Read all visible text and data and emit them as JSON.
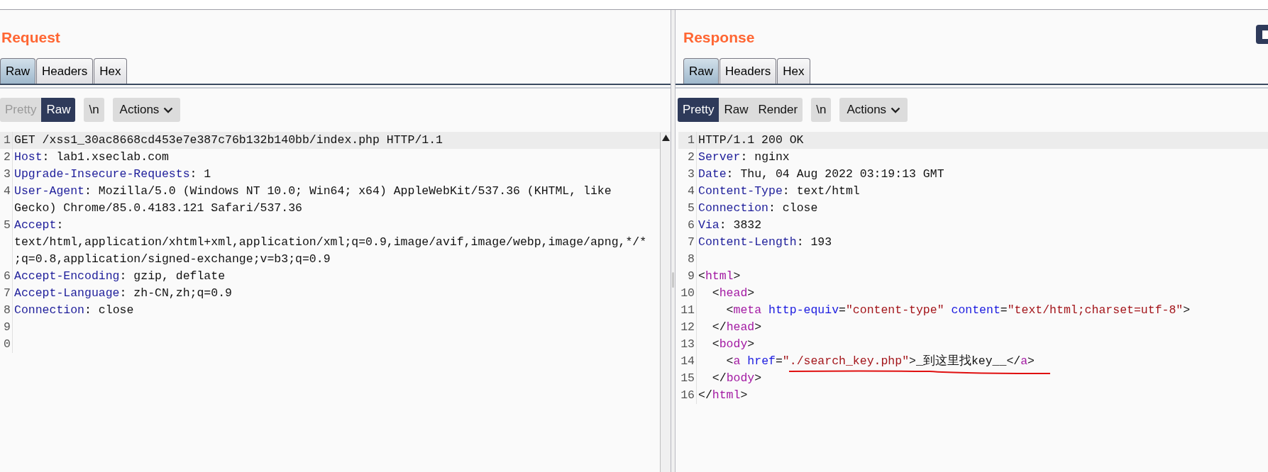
{
  "request": {
    "title": "Request",
    "tabs": [
      {
        "label": "Raw",
        "selected": true
      },
      {
        "label": "Headers",
        "selected": false
      },
      {
        "label": "Hex",
        "selected": false
      }
    ],
    "view_modes": [
      {
        "label": "Pretty",
        "selected": false,
        "disabled": true
      },
      {
        "label": "Raw",
        "selected": true,
        "disabled": false
      }
    ],
    "newline_button": "\\n",
    "actions_button": "Actions",
    "lines": [
      {
        "number": "1",
        "highlighted": true,
        "segments": [
          {
            "kind": "plain",
            "text": "GET /xss1_30ac8668cd453e7e387c76b132b140bb/index.php HTTP/1.1"
          }
        ]
      },
      {
        "number": "2",
        "highlighted": false,
        "segments": [
          {
            "kind": "header_name",
            "text": "Host"
          },
          {
            "kind": "plain",
            "text": ": lab1.xseclab.com"
          }
        ]
      },
      {
        "number": "3",
        "highlighted": false,
        "segments": [
          {
            "kind": "header_name",
            "text": "Upgrade-Insecure-Requests"
          },
          {
            "kind": "plain",
            "text": ": 1"
          }
        ]
      },
      {
        "number": "4",
        "highlighted": false,
        "segments": [
          {
            "kind": "header_name",
            "text": "User-Agent"
          },
          {
            "kind": "plain",
            "text": ": Mozilla/5.0 (Windows NT 10.0; Win64; x64) AppleWebKit/537.36 (KHTML, like Gecko) Chrome/85.0.4183.121 Safari/537.36"
          }
        ]
      },
      {
        "number": "5",
        "highlighted": false,
        "segments": [
          {
            "kind": "header_name",
            "text": "Accept"
          },
          {
            "kind": "plain",
            "text": ": text/html,application/xhtml+xml,application/xml;q=0.9,image/avif,image/webp,image/apng,*/*;q=0.8,application/signed-exchange;v=b3;q=0.9"
          }
        ]
      },
      {
        "number": "6",
        "highlighted": false,
        "segments": [
          {
            "kind": "header_name",
            "text": "Accept-Encoding"
          },
          {
            "kind": "plain",
            "text": ": gzip, deflate"
          }
        ]
      },
      {
        "number": "7",
        "highlighted": false,
        "segments": [
          {
            "kind": "header_name",
            "text": "Accept-Language"
          },
          {
            "kind": "plain",
            "text": ": zh-CN,zh;q=0.9"
          }
        ]
      },
      {
        "number": "8",
        "highlighted": false,
        "segments": [
          {
            "kind": "header_name",
            "text": "Connection"
          },
          {
            "kind": "plain",
            "text": ": close"
          }
        ]
      },
      {
        "number": "9",
        "highlighted": false
      },
      {
        "number": "0",
        "highlighted": false
      }
    ]
  },
  "response": {
    "title": "Response",
    "tabs": [
      {
        "label": "Raw",
        "selected": true
      },
      {
        "label": "Headers",
        "selected": false
      },
      {
        "label": "Hex",
        "selected": false
      }
    ],
    "view_modes": [
      {
        "label": "Pretty",
        "selected": true,
        "disabled": false
      },
      {
        "label": "Raw",
        "selected": false,
        "disabled": false
      },
      {
        "label": "Render",
        "selected": false,
        "disabled": false
      }
    ],
    "newline_button": "\\n",
    "actions_button": "Actions",
    "lines": [
      {
        "number": "1",
        "highlighted": true,
        "underlined": false,
        "segments": [
          {
            "kind": "plain",
            "text": "HTTP/1.1 200 OK"
          }
        ]
      },
      {
        "number": "2",
        "highlighted": false,
        "underlined": false,
        "segments": [
          {
            "kind": "header_name",
            "text": "Server"
          },
          {
            "kind": "plain",
            "text": ": nginx"
          }
        ]
      },
      {
        "number": "3",
        "highlighted": false,
        "underlined": false,
        "segments": [
          {
            "kind": "header_name",
            "text": "Date"
          },
          {
            "kind": "plain",
            "text": ": Thu, 04 Aug 2022 03:19:13 GMT"
          }
        ]
      },
      {
        "number": "4",
        "highlighted": false,
        "underlined": false,
        "segments": [
          {
            "kind": "header_name",
            "text": "Content-Type"
          },
          {
            "kind": "plain",
            "text": ": text/html"
          }
        ]
      },
      {
        "number": "5",
        "highlighted": false,
        "underlined": false,
        "segments": [
          {
            "kind": "header_name",
            "text": "Connection"
          },
          {
            "kind": "plain",
            "text": ": close"
          }
        ]
      },
      {
        "number": "6",
        "highlighted": false,
        "underlined": false,
        "segments": [
          {
            "kind": "header_name",
            "text": "Via"
          },
          {
            "kind": "plain",
            "text": ": 3832"
          }
        ]
      },
      {
        "number": "7",
        "highlighted": false,
        "underlined": false,
        "segments": [
          {
            "kind": "header_name",
            "text": "Content-Length"
          },
          {
            "kind": "plain",
            "text": ": 193"
          }
        ]
      },
      {
        "number": "8",
        "highlighted": false,
        "underlined": false
      },
      {
        "number": "9",
        "highlighted": false,
        "underlined": false,
        "segments": [
          {
            "kind": "plain",
            "text": "<"
          },
          {
            "kind": "tag",
            "text": "html"
          },
          {
            "kind": "plain",
            "text": ">"
          }
        ]
      },
      {
        "number": "10",
        "highlighted": false,
        "underlined": false,
        "segments": [
          {
            "kind": "plain",
            "text": "  <"
          },
          {
            "kind": "tag",
            "text": "head"
          },
          {
            "kind": "plain",
            "text": ">"
          }
        ]
      },
      {
        "number": "11",
        "highlighted": false,
        "underlined": false,
        "segments": [
          {
            "kind": "plain",
            "text": "    <"
          },
          {
            "kind": "tag",
            "text": "meta"
          },
          {
            "kind": "attr",
            "text": " http-equiv"
          },
          {
            "kind": "plain",
            "text": "="
          },
          {
            "kind": "attr_value",
            "text": "\"content-type\""
          },
          {
            "kind": "attr",
            "text": " content"
          },
          {
            "kind": "plain",
            "text": "="
          },
          {
            "kind": "attr_value",
            "text": "\"text/html;charset=utf-8\""
          },
          {
            "kind": "plain",
            "text": ">"
          }
        ]
      },
      {
        "number": "12",
        "highlighted": false,
        "underlined": false,
        "segments": [
          {
            "kind": "plain",
            "text": "  </"
          },
          {
            "kind": "tag",
            "text": "head"
          },
          {
            "kind": "plain",
            "text": ">"
          }
        ]
      },
      {
        "number": "13",
        "highlighted": false,
        "underlined": false,
        "segments": [
          {
            "kind": "plain",
            "text": "  <"
          },
          {
            "kind": "tag",
            "text": "body"
          },
          {
            "kind": "plain",
            "text": ">"
          }
        ]
      },
      {
        "number": "14",
        "highlighted": false,
        "underlined": true,
        "segments": [
          {
            "kind": "plain",
            "text": "    <"
          },
          {
            "kind": "tag",
            "text": "a"
          },
          {
            "kind": "attr",
            "text": " href"
          },
          {
            "kind": "plain",
            "text": "="
          },
          {
            "kind": "attr_value",
            "text": "\"./search_key.php\""
          },
          {
            "kind": "plain",
            "text": ">_到这里找key__</"
          },
          {
            "kind": "tag",
            "text": "a"
          },
          {
            "kind": "plain",
            "text": ">"
          }
        ]
      },
      {
        "number": "15",
        "highlighted": false,
        "underlined": false,
        "segments": [
          {
            "kind": "plain",
            "text": "  </"
          },
          {
            "kind": "tag",
            "text": "body"
          },
          {
            "kind": "plain",
            "text": ">"
          }
        ]
      },
      {
        "number": "16",
        "highlighted": false,
        "underlined": false,
        "segments": [
          {
            "kind": "plain",
            "text": "</"
          },
          {
            "kind": "tag",
            "text": "html"
          },
          {
            "kind": "plain",
            "text": ">"
          }
        ]
      }
    ]
  }
}
